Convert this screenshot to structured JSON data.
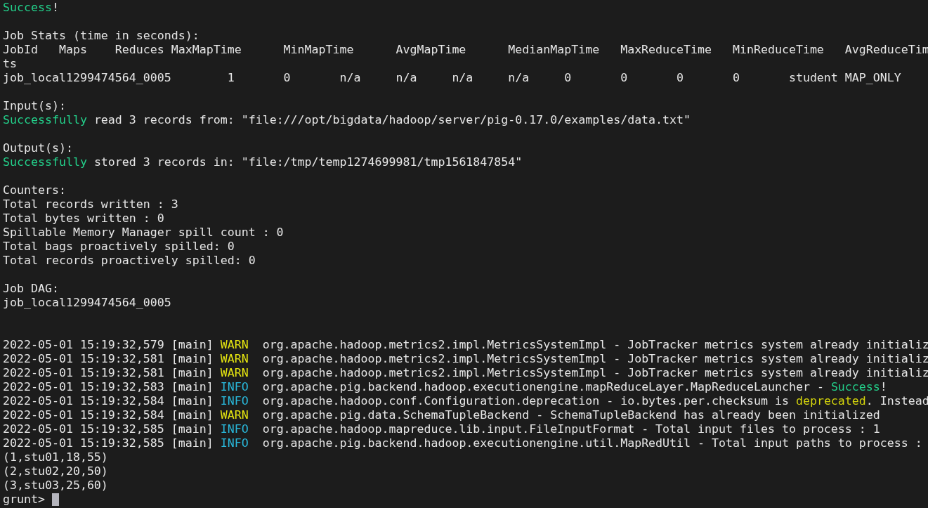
{
  "terminal": {
    "lines": [
      {
        "kind": "text",
        "segments": [
          {
            "kind": "success",
            "text": "Success"
          },
          {
            "kind": "plain",
            "text": "!"
          }
        ]
      },
      {
        "kind": "blank"
      },
      {
        "kind": "text",
        "segments": [
          {
            "kind": "plain",
            "text": "Job Stats (time in seconds):"
          }
        ]
      },
      {
        "kind": "text",
        "segments": [
          {
            "kind": "plain",
            "text": "JobId   Maps    Reduces MaxMapTime      MinMapTime      AvgMapTime      MedianMapTime   MaxReduceTime   MinReduceTime   AvgReduceTim"
          }
        ]
      },
      {
        "kind": "text",
        "segments": [
          {
            "kind": "plain",
            "text": "ts"
          }
        ]
      },
      {
        "kind": "text",
        "segments": [
          {
            "kind": "plain",
            "text": "job_local1299474564_0005        1       0       n/a     n/a     n/a     n/a     0       0       0       0       student MAP_ONLY"
          }
        ]
      },
      {
        "kind": "blank"
      },
      {
        "kind": "text",
        "segments": [
          {
            "kind": "plain",
            "text": "Input(s):"
          }
        ]
      },
      {
        "kind": "text",
        "segments": [
          {
            "kind": "success",
            "text": "Successfully"
          },
          {
            "kind": "plain",
            "text": " read 3 records from: \"file:///opt/bigdata/hadoop/server/pig-0.17.0/examples/data.txt\""
          }
        ]
      },
      {
        "kind": "blank"
      },
      {
        "kind": "text",
        "segments": [
          {
            "kind": "plain",
            "text": "Output(s):"
          }
        ]
      },
      {
        "kind": "text",
        "segments": [
          {
            "kind": "success",
            "text": "Successfully"
          },
          {
            "kind": "plain",
            "text": " stored 3 records in: \"file:/tmp/temp1274699981/tmp1561847854\""
          }
        ]
      },
      {
        "kind": "blank"
      },
      {
        "kind": "text",
        "segments": [
          {
            "kind": "plain",
            "text": "Counters:"
          }
        ]
      },
      {
        "kind": "text",
        "segments": [
          {
            "kind": "plain",
            "text": "Total records written : 3"
          }
        ]
      },
      {
        "kind": "text",
        "segments": [
          {
            "kind": "plain",
            "text": "Total bytes written : 0"
          }
        ]
      },
      {
        "kind": "text",
        "segments": [
          {
            "kind": "plain",
            "text": "Spillable Memory Manager spill count : 0"
          }
        ]
      },
      {
        "kind": "text",
        "segments": [
          {
            "kind": "plain",
            "text": "Total bags proactively spilled: 0"
          }
        ]
      },
      {
        "kind": "text",
        "segments": [
          {
            "kind": "plain",
            "text": "Total records proactively spilled: 0"
          }
        ]
      },
      {
        "kind": "blank"
      },
      {
        "kind": "text",
        "segments": [
          {
            "kind": "plain",
            "text": "Job DAG:"
          }
        ]
      },
      {
        "kind": "text",
        "segments": [
          {
            "kind": "plain",
            "text": "job_local1299474564_0005"
          }
        ]
      },
      {
        "kind": "blank"
      },
      {
        "kind": "blank"
      },
      {
        "kind": "text",
        "segments": [
          {
            "kind": "plain",
            "text": "2022-05-01 15:19:32,579 [main] "
          },
          {
            "kind": "warn",
            "text": "WARN"
          },
          {
            "kind": "plain",
            "text": "  org.apache.hadoop.metrics2.impl.MetricsSystemImpl - JobTracker metrics system already initializ"
          }
        ]
      },
      {
        "kind": "text",
        "segments": [
          {
            "kind": "plain",
            "text": "2022-05-01 15:19:32,581 [main] "
          },
          {
            "kind": "warn",
            "text": "WARN"
          },
          {
            "kind": "plain",
            "text": "  org.apache.hadoop.metrics2.impl.MetricsSystemImpl - JobTracker metrics system already initializ"
          }
        ]
      },
      {
        "kind": "text",
        "segments": [
          {
            "kind": "plain",
            "text": "2022-05-01 15:19:32,581 [main] "
          },
          {
            "kind": "warn",
            "text": "WARN"
          },
          {
            "kind": "plain",
            "text": "  org.apache.hadoop.metrics2.impl.MetricsSystemImpl - JobTracker metrics system already initializ"
          }
        ]
      },
      {
        "kind": "text",
        "segments": [
          {
            "kind": "plain",
            "text": "2022-05-01 15:19:32,583 [main] "
          },
          {
            "kind": "info",
            "text": "INFO"
          },
          {
            "kind": "plain",
            "text": "  org.apache.pig.backend.hadoop.executionengine.mapReduceLayer.MapReduceLauncher - "
          },
          {
            "kind": "success",
            "text": "Success"
          },
          {
            "kind": "plain",
            "text": "!"
          }
        ]
      },
      {
        "kind": "text",
        "segments": [
          {
            "kind": "plain",
            "text": "2022-05-01 15:19:32,584 [main] "
          },
          {
            "kind": "info",
            "text": "INFO"
          },
          {
            "kind": "plain",
            "text": "  org.apache.hadoop.conf.Configuration.deprecation - io.bytes.per.checksum is "
          },
          {
            "kind": "highlight",
            "text": "deprecated"
          },
          {
            "kind": "plain",
            "text": ". Instead"
          }
        ]
      },
      {
        "kind": "text",
        "segments": [
          {
            "kind": "plain",
            "text": "2022-05-01 15:19:32,584 [main] "
          },
          {
            "kind": "warn",
            "text": "WARN"
          },
          {
            "kind": "plain",
            "text": "  org.apache.pig.data.SchemaTupleBackend - SchemaTupleBackend has already been initialized"
          }
        ]
      },
      {
        "kind": "text",
        "segments": [
          {
            "kind": "plain",
            "text": "2022-05-01 15:19:32,585 [main] "
          },
          {
            "kind": "info",
            "text": "INFO"
          },
          {
            "kind": "plain",
            "text": "  org.apache.hadoop.mapreduce.lib.input.FileInputFormat - Total input files to process : 1"
          }
        ]
      },
      {
        "kind": "text",
        "segments": [
          {
            "kind": "plain",
            "text": "2022-05-01 15:19:32,585 [main] "
          },
          {
            "kind": "info",
            "text": "INFO"
          },
          {
            "kind": "plain",
            "text": "  org.apache.pig.backend.hadoop.executionengine.util.MapRedUtil - Total input paths to process :"
          }
        ]
      },
      {
        "kind": "text",
        "segments": [
          {
            "kind": "plain",
            "text": "(1,stu01,18,55)"
          }
        ]
      },
      {
        "kind": "text",
        "segments": [
          {
            "kind": "plain",
            "text": "(2,stu02,20,50)"
          }
        ]
      },
      {
        "kind": "text",
        "segments": [
          {
            "kind": "plain",
            "text": "(3,stu03,25,60)"
          }
        ]
      },
      {
        "kind": "prompt",
        "text": "grunt>"
      }
    ]
  }
}
